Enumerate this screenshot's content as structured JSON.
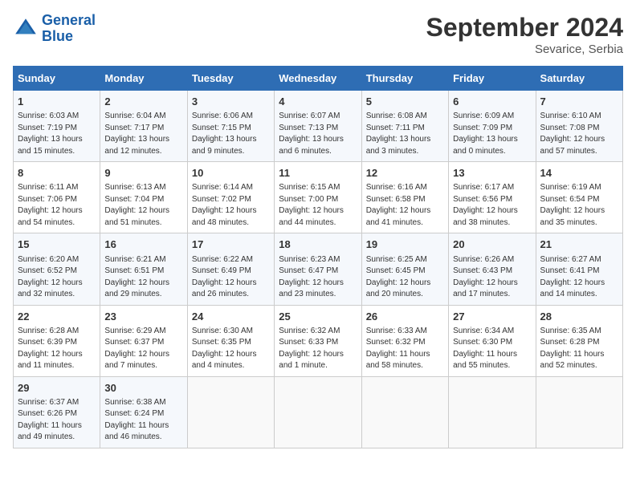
{
  "header": {
    "logo_line1": "General",
    "logo_line2": "Blue",
    "month": "September 2024",
    "location": "Sevarice, Serbia"
  },
  "weekdays": [
    "Sunday",
    "Monday",
    "Tuesday",
    "Wednesday",
    "Thursday",
    "Friday",
    "Saturday"
  ],
  "rows": [
    [
      {
        "day": "1",
        "lines": [
          "Sunrise: 6:03 AM",
          "Sunset: 7:19 PM",
          "Daylight: 13 hours",
          "and 15 minutes."
        ]
      },
      {
        "day": "2",
        "lines": [
          "Sunrise: 6:04 AM",
          "Sunset: 7:17 PM",
          "Daylight: 13 hours",
          "and 12 minutes."
        ]
      },
      {
        "day": "3",
        "lines": [
          "Sunrise: 6:06 AM",
          "Sunset: 7:15 PM",
          "Daylight: 13 hours",
          "and 9 minutes."
        ]
      },
      {
        "day": "4",
        "lines": [
          "Sunrise: 6:07 AM",
          "Sunset: 7:13 PM",
          "Daylight: 13 hours",
          "and 6 minutes."
        ]
      },
      {
        "day": "5",
        "lines": [
          "Sunrise: 6:08 AM",
          "Sunset: 7:11 PM",
          "Daylight: 13 hours",
          "and 3 minutes."
        ]
      },
      {
        "day": "6",
        "lines": [
          "Sunrise: 6:09 AM",
          "Sunset: 7:09 PM",
          "Daylight: 13 hours",
          "and 0 minutes."
        ]
      },
      {
        "day": "7",
        "lines": [
          "Sunrise: 6:10 AM",
          "Sunset: 7:08 PM",
          "Daylight: 12 hours",
          "and 57 minutes."
        ]
      }
    ],
    [
      {
        "day": "8",
        "lines": [
          "Sunrise: 6:11 AM",
          "Sunset: 7:06 PM",
          "Daylight: 12 hours",
          "and 54 minutes."
        ]
      },
      {
        "day": "9",
        "lines": [
          "Sunrise: 6:13 AM",
          "Sunset: 7:04 PM",
          "Daylight: 12 hours",
          "and 51 minutes."
        ]
      },
      {
        "day": "10",
        "lines": [
          "Sunrise: 6:14 AM",
          "Sunset: 7:02 PM",
          "Daylight: 12 hours",
          "and 48 minutes."
        ]
      },
      {
        "day": "11",
        "lines": [
          "Sunrise: 6:15 AM",
          "Sunset: 7:00 PM",
          "Daylight: 12 hours",
          "and 44 minutes."
        ]
      },
      {
        "day": "12",
        "lines": [
          "Sunrise: 6:16 AM",
          "Sunset: 6:58 PM",
          "Daylight: 12 hours",
          "and 41 minutes."
        ]
      },
      {
        "day": "13",
        "lines": [
          "Sunrise: 6:17 AM",
          "Sunset: 6:56 PM",
          "Daylight: 12 hours",
          "and 38 minutes."
        ]
      },
      {
        "day": "14",
        "lines": [
          "Sunrise: 6:19 AM",
          "Sunset: 6:54 PM",
          "Daylight: 12 hours",
          "and 35 minutes."
        ]
      }
    ],
    [
      {
        "day": "15",
        "lines": [
          "Sunrise: 6:20 AM",
          "Sunset: 6:52 PM",
          "Daylight: 12 hours",
          "and 32 minutes."
        ]
      },
      {
        "day": "16",
        "lines": [
          "Sunrise: 6:21 AM",
          "Sunset: 6:51 PM",
          "Daylight: 12 hours",
          "and 29 minutes."
        ]
      },
      {
        "day": "17",
        "lines": [
          "Sunrise: 6:22 AM",
          "Sunset: 6:49 PM",
          "Daylight: 12 hours",
          "and 26 minutes."
        ]
      },
      {
        "day": "18",
        "lines": [
          "Sunrise: 6:23 AM",
          "Sunset: 6:47 PM",
          "Daylight: 12 hours",
          "and 23 minutes."
        ]
      },
      {
        "day": "19",
        "lines": [
          "Sunrise: 6:25 AM",
          "Sunset: 6:45 PM",
          "Daylight: 12 hours",
          "and 20 minutes."
        ]
      },
      {
        "day": "20",
        "lines": [
          "Sunrise: 6:26 AM",
          "Sunset: 6:43 PM",
          "Daylight: 12 hours",
          "and 17 minutes."
        ]
      },
      {
        "day": "21",
        "lines": [
          "Sunrise: 6:27 AM",
          "Sunset: 6:41 PM",
          "Daylight: 12 hours",
          "and 14 minutes."
        ]
      }
    ],
    [
      {
        "day": "22",
        "lines": [
          "Sunrise: 6:28 AM",
          "Sunset: 6:39 PM",
          "Daylight: 12 hours",
          "and 11 minutes."
        ]
      },
      {
        "day": "23",
        "lines": [
          "Sunrise: 6:29 AM",
          "Sunset: 6:37 PM",
          "Daylight: 12 hours",
          "and 7 minutes."
        ]
      },
      {
        "day": "24",
        "lines": [
          "Sunrise: 6:30 AM",
          "Sunset: 6:35 PM",
          "Daylight: 12 hours",
          "and 4 minutes."
        ]
      },
      {
        "day": "25",
        "lines": [
          "Sunrise: 6:32 AM",
          "Sunset: 6:33 PM",
          "Daylight: 12 hours",
          "and 1 minute."
        ]
      },
      {
        "day": "26",
        "lines": [
          "Sunrise: 6:33 AM",
          "Sunset: 6:32 PM",
          "Daylight: 11 hours",
          "and 58 minutes."
        ]
      },
      {
        "day": "27",
        "lines": [
          "Sunrise: 6:34 AM",
          "Sunset: 6:30 PM",
          "Daylight: 11 hours",
          "and 55 minutes."
        ]
      },
      {
        "day": "28",
        "lines": [
          "Sunrise: 6:35 AM",
          "Sunset: 6:28 PM",
          "Daylight: 11 hours",
          "and 52 minutes."
        ]
      }
    ],
    [
      {
        "day": "29",
        "lines": [
          "Sunrise: 6:37 AM",
          "Sunset: 6:26 PM",
          "Daylight: 11 hours",
          "and 49 minutes."
        ]
      },
      {
        "day": "30",
        "lines": [
          "Sunrise: 6:38 AM",
          "Sunset: 6:24 PM",
          "Daylight: 11 hours",
          "and 46 minutes."
        ]
      },
      {
        "day": "",
        "lines": []
      },
      {
        "day": "",
        "lines": []
      },
      {
        "day": "",
        "lines": []
      },
      {
        "day": "",
        "lines": []
      },
      {
        "day": "",
        "lines": []
      }
    ]
  ]
}
